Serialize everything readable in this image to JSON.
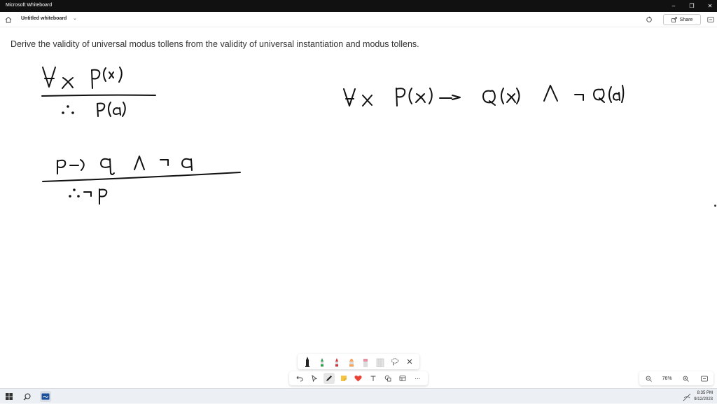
{
  "window": {
    "app_title": "Microsoft Whiteboard",
    "minimize_icon": "minimize-icon",
    "restore_icon": "restore-icon",
    "close_icon": "close-icon"
  },
  "appbar": {
    "board_name": "Untitled whiteboard",
    "share_label": "Share"
  },
  "canvas": {
    "question": "Derive the validity of universal modus tollens from the validity of universal instantiation and modus tollens.",
    "handwriting": {
      "premise_1": "∀x P(x)",
      "conclusion_1": "∴ P(a)",
      "premise_2": "p→q ∧ ¬q",
      "conclusion_2": "∴¬p",
      "right_expression": "∀x P(x)→Q(x) ∧ ¬Q(a)"
    },
    "ink_color": "#111111"
  },
  "pen_tray": {
    "pens": [
      {
        "name": "black-pen",
        "color": "#222222"
      },
      {
        "name": "green-pen",
        "color": "#2e9e4f"
      },
      {
        "name": "red-pen",
        "color": "#d13438"
      },
      {
        "name": "orange-highlighter",
        "color": "#f7a35c"
      },
      {
        "name": "pink-highlighter",
        "color": "#e88fa1"
      },
      {
        "name": "eraser",
        "color": "#bdbdbd"
      }
    ]
  },
  "toolbar": {
    "tools": [
      "undo-icon",
      "select-icon",
      "pen-icon",
      "sticky-note-icon",
      "reactions-icon",
      "text-icon",
      "shapes-icon",
      "templates-icon",
      "more-icon"
    ],
    "active_tool": "pen-icon"
  },
  "zoom": {
    "level": "76%"
  },
  "taskbar": {
    "time": "8:35 PM",
    "date": "9/12/2023"
  }
}
